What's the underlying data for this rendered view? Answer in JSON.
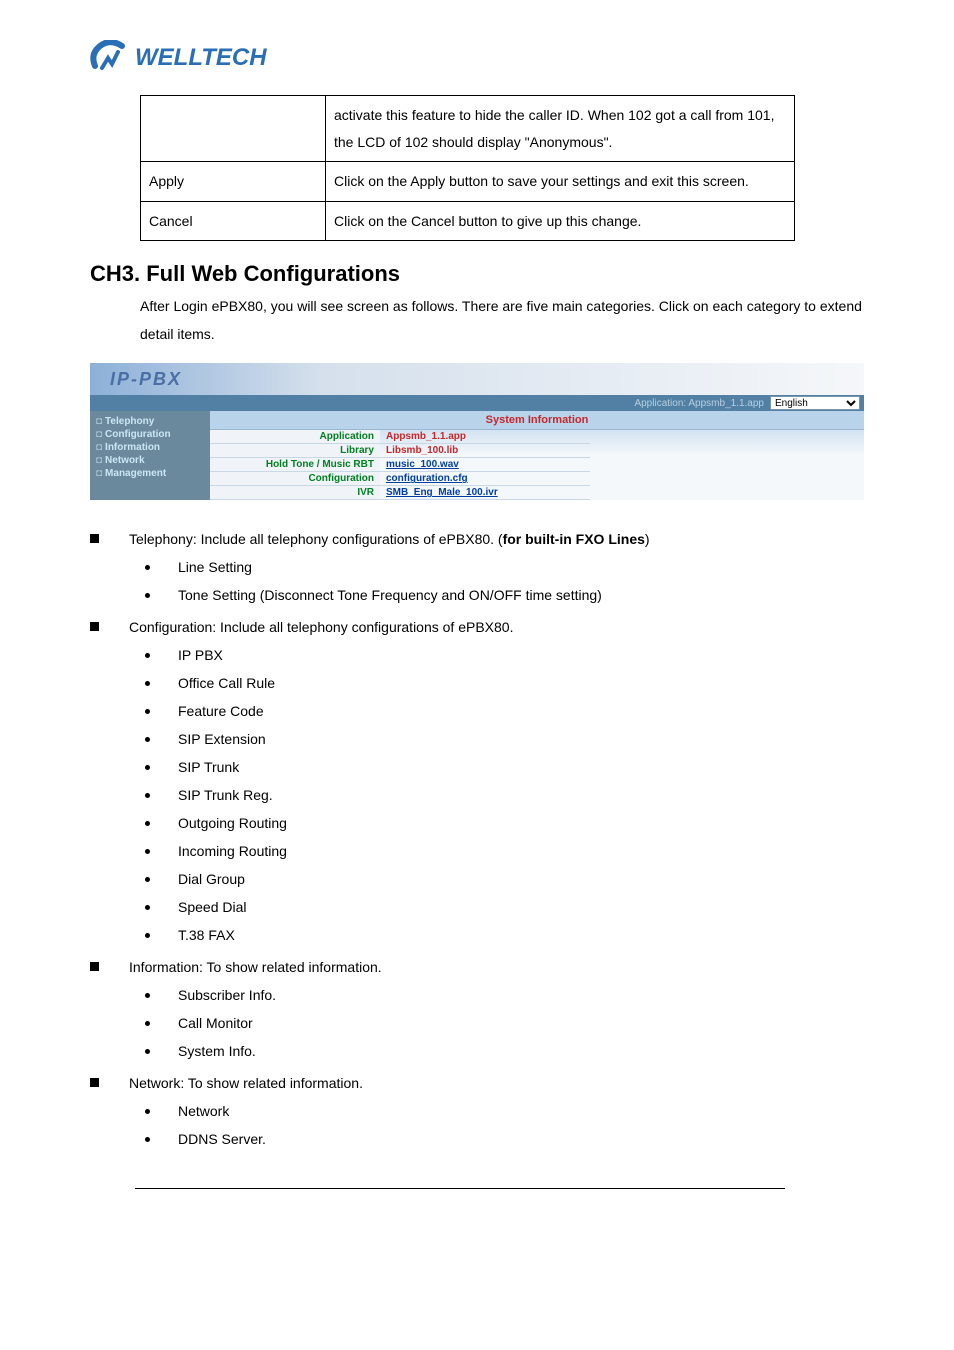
{
  "logo_text": "WELLTECH",
  "config_table": {
    "row1_col2": "activate this feature to hide the caller ID. When 102 got a call from 101, the LCD of 102 should display \"Anonymous\".",
    "row2_col1": "Apply",
    "row2_col2": "Click on the Apply button to save your settings and exit this screen.",
    "row3_col1": "Cancel",
    "row3_col2": "Click on the Cancel button to give up this change."
  },
  "chapter": {
    "heading": "CH3.  Full Web Configurations",
    "intro": "After Login ePBX80, you will see screen as follows. There are five main categories. Click on each category to extend detail items."
  },
  "screenshot": {
    "logo": "IP-PBX",
    "toolbar_text": "Application: Appsmb_1.1.app",
    "language": "English",
    "sidebar": [
      "Telephony",
      "Configuration",
      "Information",
      "Network",
      "Management"
    ],
    "main_header": "System Information",
    "rows": [
      {
        "label": "Application",
        "value": "Appsmb_1.1.app",
        "link": false
      },
      {
        "label": "Library",
        "value": "Libsmb_100.lib",
        "link": false
      },
      {
        "label": "Hold Tone / Music RBT",
        "value": "music_100.wav",
        "link": true
      },
      {
        "label": "Configuration",
        "value": "configuration.cfg",
        "link": true
      },
      {
        "label": "IVR",
        "value": "SMB_Eng_Male_100.ivr",
        "link": true
      }
    ]
  },
  "sections": [
    {
      "title_pre": "Telephony: Include all telephony configurations of ePBX80. (",
      "title_bold": "for built-in FXO Lines",
      "title_post": ")",
      "items": [
        "Line Setting",
        "Tone Setting (Disconnect Tone Frequency and ON/OFF time setting)"
      ]
    },
    {
      "title_pre": "Configuration: Include all telephony configurations of ePBX80.",
      "title_bold": "",
      "title_post": "",
      "items": [
        "IP PBX",
        "Office Call Rule",
        "Feature Code",
        "SIP Extension",
        "SIP Trunk",
        "SIP Trunk Reg.",
        "Outgoing Routing",
        "Incoming Routing",
        "Dial Group",
        "Speed Dial",
        "T.38 FAX"
      ]
    },
    {
      "title_pre": "Information: To show related information.",
      "title_bold": "",
      "title_post": "",
      "items": [
        "Subscriber Info.",
        "Call Monitor",
        "System Info."
      ]
    },
    {
      "title_pre": "Network: To show related information.",
      "title_bold": "",
      "title_post": "",
      "items": [
        "Network",
        "DDNS Server."
      ]
    }
  ]
}
